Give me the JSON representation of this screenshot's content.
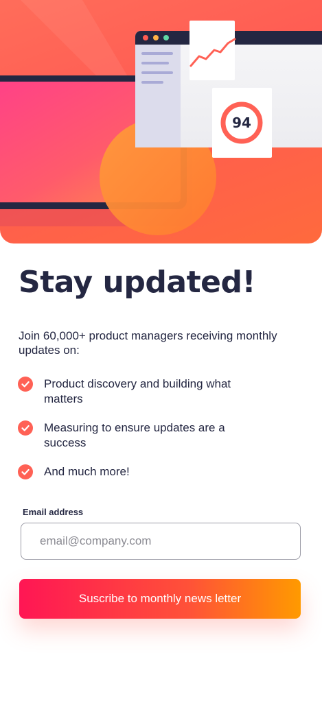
{
  "hero": {
    "score": "94",
    "colors": {
      "navy": "#242742",
      "coral": "#ff6155",
      "pink": "#ff3f8a"
    }
  },
  "title": "Stay updated!",
  "intro": "Join 60,000+ product managers receiving monthly updates on:",
  "features": [
    {
      "label": "Product discovery and building what matters",
      "icon": "check-icon"
    },
    {
      "label": "Measuring to ensure updates are a success",
      "icon": "check-icon"
    },
    {
      "label": "And much more!",
      "icon": "check-icon"
    }
  ],
  "form": {
    "email_label": "Email address",
    "email_placeholder": "email@company.com",
    "email_value": "",
    "submit_label": "Suscribe to monthly news letter"
  },
  "colors": {
    "text": "#242742",
    "accent": "#ff6155",
    "button_gradient": [
      "#ff1654",
      "#ff9a00"
    ]
  }
}
